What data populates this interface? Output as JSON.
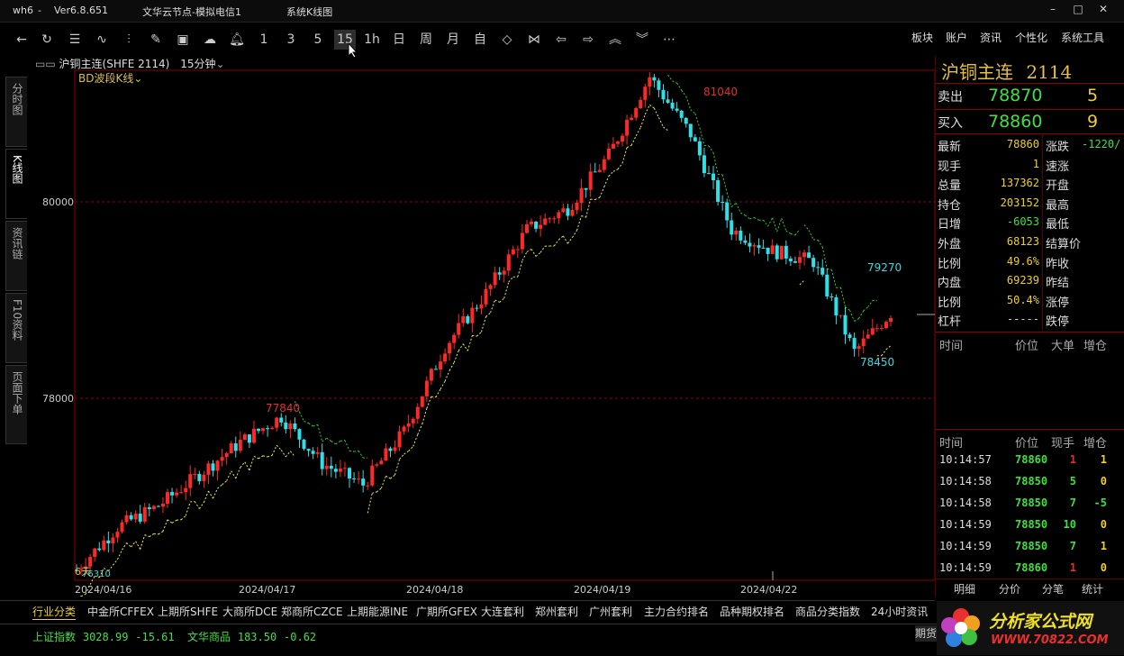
{
  "titlebar": {
    "app": "wh6",
    "sep": "-",
    "version": "Ver6.8.651",
    "server": "文华云节点-模拟电信1",
    "window_title": "系统K线图"
  },
  "toolbar": {
    "periods": [
      "1",
      "3",
      "5",
      "15",
      "1h",
      "日",
      "周",
      "月",
      "自"
    ],
    "menu": [
      "板块",
      "账户",
      "资讯",
      "个性化",
      "系统工具"
    ]
  },
  "sidetabs": [
    "分时图",
    "K线图",
    "资讯链",
    "F10资料",
    "页面下单"
  ],
  "chart": {
    "symbol_label": "沪铜主连(SHFE 2114)",
    "period_label": "15分钟",
    "indicator_label": "BD波段K线",
    "y_labels": [
      "80000",
      "78000"
    ],
    "x_labels": [
      "2024/04/16",
      "2024/04/17",
      "2024/04/18",
      "2024/04/19",
      "2024/04/22"
    ],
    "annotations": {
      "high": "81040",
      "mid_high": "77840",
      "last_level": "79270",
      "low": "78450",
      "left_low": "76310"
    },
    "bottom_note": "6天"
  },
  "chart_data": {
    "type": "candlestick",
    "title": "沪铜主连(SHFE 2114) 15分钟",
    "ylim": [
      76300,
      81100
    ],
    "x_labels": [
      "2024/04/16",
      "2024/04/17",
      "2024/04/18",
      "2024/04/19",
      "2024/04/22"
    ],
    "marked_values": {
      "high": 81040,
      "low": 78450,
      "swing_high": 77840,
      "stop_line": 79270,
      "left_low": 76310
    },
    "key_levels": [
      76400,
      76800,
      77000,
      77300,
      77600,
      77840,
      77400,
      77200,
      77700,
      78500,
      79000,
      79600,
      79800,
      80300,
      81040,
      80500,
      79600,
      79400,
      79300,
      78450,
      78860
    ]
  },
  "quote": {
    "name": "沪铜主连",
    "code": "2114",
    "ask_label": "卖出",
    "ask": "78870",
    "ask_vol": "5",
    "bid_label": "买入",
    "bid": "78860",
    "bid_vol": "9",
    "fields": [
      {
        "l": "最新",
        "v": "78860",
        "r": "涨跌",
        "rv": "-1220/"
      },
      {
        "l": "现手",
        "v": "1",
        "r": "速涨",
        "rv": ""
      },
      {
        "l": "总量",
        "v": "137362",
        "r": "开盘",
        "rv": ""
      },
      {
        "l": "持仓",
        "v": "203152",
        "r": "最高",
        "rv": ""
      },
      {
        "l": "日增",
        "v": "-6053",
        "r": "最低",
        "rv": ""
      },
      {
        "l": "外盘",
        "v": "68123",
        "r": "结算价",
        "rv": ""
      },
      {
        "l": "比例",
        "v": "49.6%",
        "r": "昨收",
        "rv": ""
      },
      {
        "l": "内盘",
        "v": "69239",
        "r": "昨结",
        "rv": ""
      },
      {
        "l": "比例",
        "v": "50.4%",
        "r": "涨停",
        "rv": ""
      },
      {
        "l": "杠杆",
        "v": "-----",
        "r": "跌停",
        "rv": ""
      }
    ],
    "order_header": [
      "时间",
      "价位",
      "大单",
      "增仓"
    ],
    "tick_header": [
      "时间",
      "价位",
      "现手",
      "增仓"
    ],
    "ticks": [
      {
        "t": "10:14:57",
        "p": "78860",
        "v": "1",
        "d": "1"
      },
      {
        "t": "10:14:58",
        "p": "78850",
        "v": "5",
        "d": "0"
      },
      {
        "t": "10:14:58",
        "p": "78850",
        "v": "7",
        "d": "-5"
      },
      {
        "t": "10:14:59",
        "p": "78850",
        "v": "10",
        "d": "0"
      },
      {
        "t": "10:14:59",
        "p": "78850",
        "v": "7",
        "d": "1"
      },
      {
        "t": "10:14:59",
        "p": "78860",
        "v": "1",
        "d": "0"
      }
    ],
    "subtabs": [
      "明细",
      "分价",
      "分笔",
      "统计"
    ]
  },
  "bottom_tabs": [
    "行业分类",
    "中金所CFFEX",
    "上期所SHFE",
    "大商所DCE",
    "郑商所CZCE",
    "上期能源INE",
    "广期所GFEX",
    "大连套利",
    "郑州套利",
    "广州套利",
    "主力合约排名",
    "品种期权排名",
    "商品分类指数",
    "24小时资讯"
  ],
  "status": {
    "index1_name": "上证指数",
    "index1_val": "3028.99",
    "index1_chg": "-15.61",
    "index2_name": "文华商品",
    "index2_val": "183.50",
    "index2_chg": "-0.62",
    "right_btn": "期货",
    "logo_text": "分析家公式网",
    "logo_url": "WWW.70822.COM"
  }
}
